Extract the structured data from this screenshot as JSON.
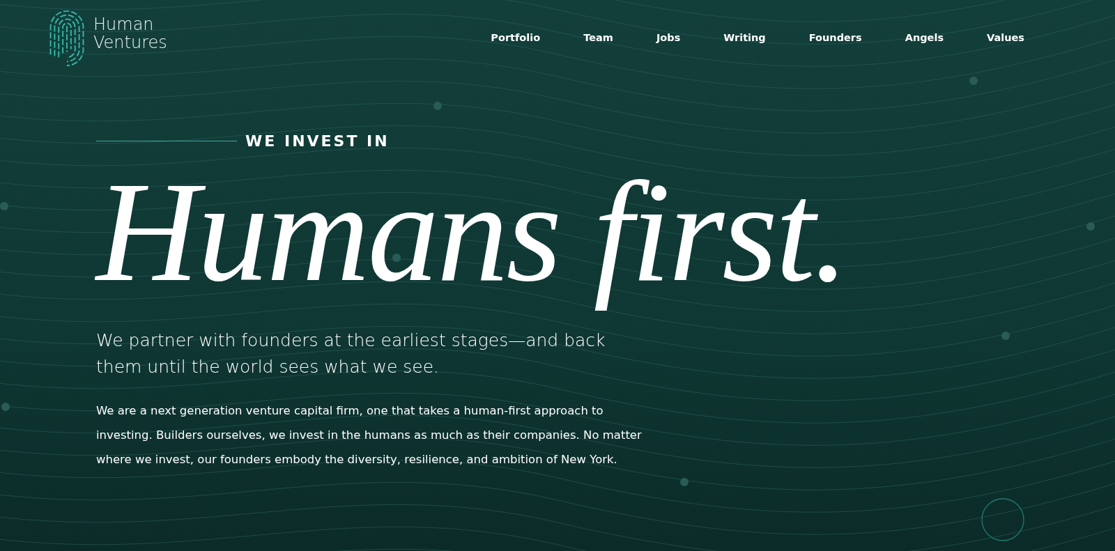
{
  "logo": {
    "line_1": "Human",
    "line_2": "Ventures"
  },
  "nav": [
    {
      "label": "Portfolio"
    },
    {
      "label": "Team"
    },
    {
      "label": "Jobs"
    },
    {
      "label": "Writing"
    },
    {
      "label": "Founders"
    },
    {
      "label": "Angels"
    },
    {
      "label": "Values"
    }
  ],
  "hero": {
    "eyebrow": "WE INVEST IN",
    "headline": "Humans first.",
    "subheadline": "We partner with founders at the earliest stages—and back them until the world sees what we see.",
    "body": "We are a next generation venture capital firm, one that takes a human-first approach to investing. Builders ourselves, we invest in the humans as much as their companies. No matter where we invest, our founders embody the diversity, resilience, and ambition of New York."
  }
}
